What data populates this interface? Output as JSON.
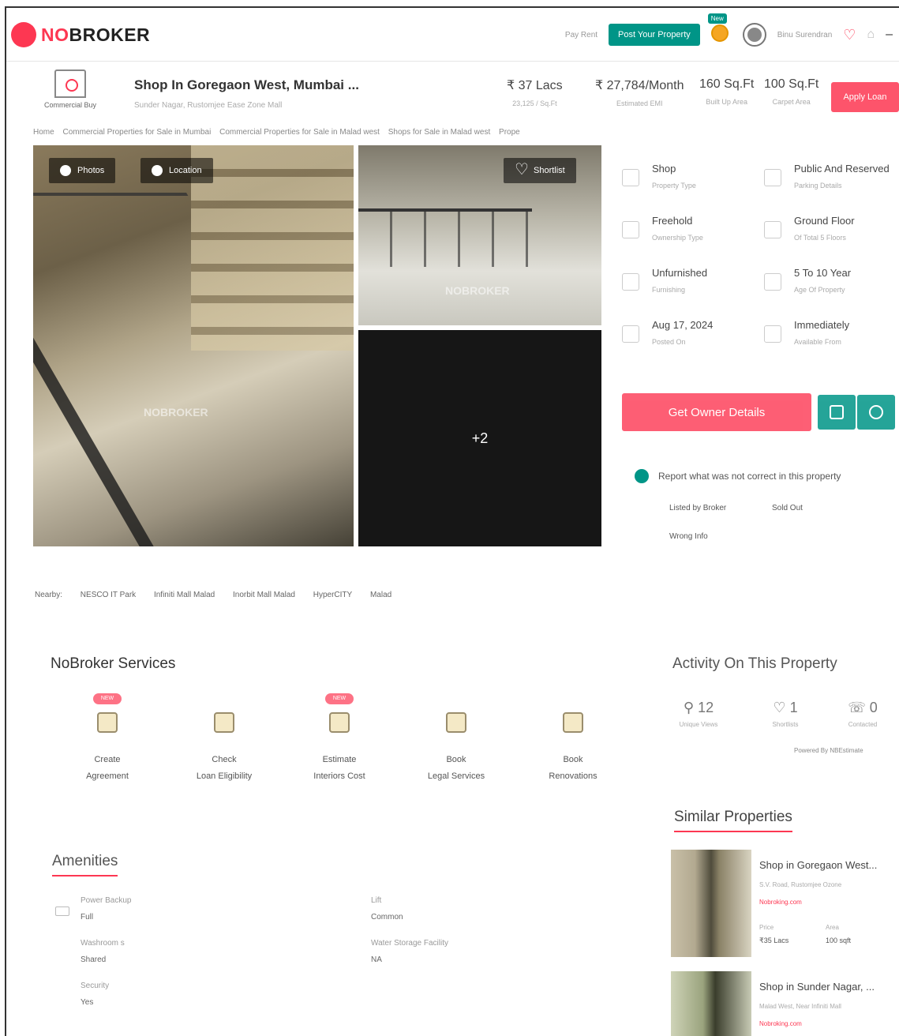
{
  "header": {
    "brand": "NOBROKER",
    "brand_accent": "NO",
    "brand_rest": "BROKER",
    "pay_rent": "Pay Rent",
    "post_property": "Post Your Property",
    "new_badge": "New",
    "user_name": "Binu Surendran",
    "menu": "–"
  },
  "property": {
    "category": "Commercial Buy",
    "title": "Shop In Goregaon West, Mumbai ...",
    "subtitle": "Sunder Nagar, Rustomjee Ease Zone Mall",
    "price": "₹ 37 Lacs",
    "price_label": "23,125 / Sq.Ft",
    "emi": "₹ 27,784/Month",
    "emi_label": "Estimated EMI",
    "builtup": "160 Sq.Ft",
    "builtup_label": "Built Up Area",
    "carpet": "100 Sq.Ft",
    "carpet_label": "Carpet Area",
    "apply_loan": "Apply Loan"
  },
  "breadcrumb": [
    "Home",
    "Commercial Properties for Sale in Mumbai",
    "Commercial Properties for Sale in Malad west",
    "Shops for Sale in Malad west",
    "Prope"
  ],
  "gallery": {
    "photos": "Photos",
    "location": "Location",
    "shortlist": "Shortlist",
    "more": "+2",
    "watermark": "NOBROKER"
  },
  "details": [
    {
      "value": "Shop",
      "label": "Property Type",
      "icon": "shop-icon"
    },
    {
      "value": "Public And Reserved",
      "label": "Parking Details",
      "icon": "parking-icon"
    },
    {
      "value": "Freehold",
      "label": "Ownership Type",
      "icon": "ownership-icon"
    },
    {
      "value": "Ground Floor",
      "label": "Of Total 5 Floors",
      "icon": "floor-icon"
    },
    {
      "value": "Unfurnished",
      "label": "Furnishing",
      "icon": "furnishing-icon"
    },
    {
      "value": "5 To 10 Year",
      "label": "Age Of Property",
      "icon": "age-icon"
    },
    {
      "value": "Aug 17, 2024",
      "label": "Posted On",
      "icon": "flag-icon"
    },
    {
      "value": "Immediately",
      "label": "Available From",
      "icon": "calendar-icon"
    }
  ],
  "actions": {
    "owner_details": "Get Owner Details"
  },
  "report": {
    "text": "Report what was not correct in this property",
    "options": [
      "Listed by Broker",
      "Sold Out",
      "Wrong Info"
    ]
  },
  "nearby": {
    "label": "Nearby:",
    "places": [
      "NESCO IT Park",
      "Infiniti Mall Malad",
      "Inorbit Mall Malad",
      "HyperCITY",
      "Malad"
    ]
  },
  "services": {
    "title": "NoBroker Services",
    "new_label": "NEW",
    "items": [
      {
        "line1": "Create",
        "line2": "Agreement",
        "is_new": true
      },
      {
        "line1": "Check",
        "line2": "Loan Eligibility",
        "is_new": false
      },
      {
        "line1": "Estimate",
        "line2": "Interiors Cost",
        "is_new": true
      },
      {
        "line1": "Book",
        "line2": "Legal Services",
        "is_new": false
      },
      {
        "line1": "Book",
        "line2": "Renovations",
        "is_new": false
      }
    ]
  },
  "activity": {
    "title": "Activity On This Property",
    "stats": [
      {
        "value": "12",
        "label": "Unique Views",
        "icon": "user-icon"
      },
      {
        "value": "1",
        "label": "Shortlists",
        "icon": "heart-icon"
      },
      {
        "value": "0",
        "label": "Contacted",
        "icon": "contact-icon"
      }
    ],
    "powered_by": "Powered By  NBEstimate"
  },
  "amenities": {
    "title": "Amenities",
    "items": [
      {
        "name": "Power Backup",
        "value": "Full"
      },
      {
        "name": "Washroom s",
        "value": "Shared"
      },
      {
        "name": "Security",
        "value": "Yes"
      },
      {
        "name": "Lift",
        "value": "Common"
      },
      {
        "name": "Water Storage Facility",
        "value": "NA"
      }
    ]
  },
  "similar": {
    "title": "Similar Properties",
    "items": [
      {
        "name": "Shop in Goregaon West...",
        "address": "S.V. Road, Rustomjee Ozone",
        "link": "Nobroking.com",
        "price": "₹35 Lacs",
        "price_label": "Price",
        "area": "100 sqft",
        "area_label": "Area"
      },
      {
        "name": "Shop in Sunder Nagar, ...",
        "address": "Malad West, Near Infiniti Mall",
        "link": "Nobroking.com",
        "price": "",
        "price_label": "",
        "area": "",
        "area_label": ""
      }
    ]
  },
  "colors": {
    "brand_red": "#fd3752",
    "teal": "#009587"
  }
}
